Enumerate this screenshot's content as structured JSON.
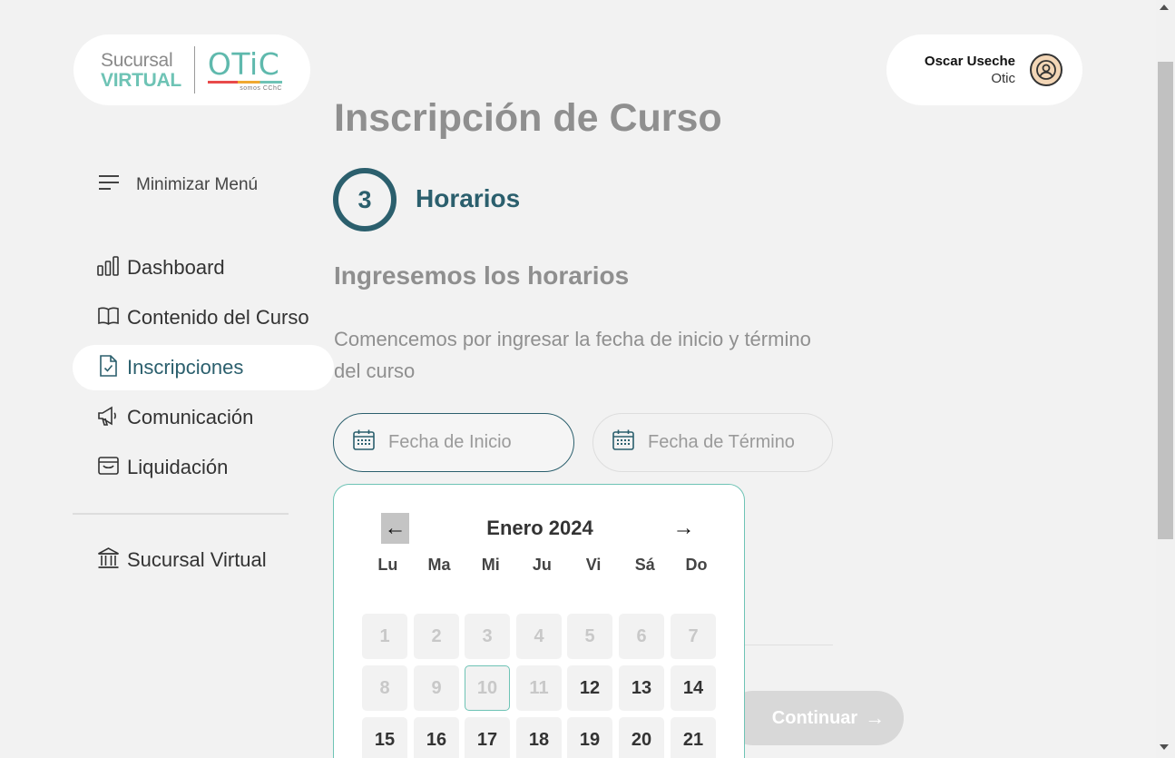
{
  "logo": {
    "line1": "Sucursal",
    "line2": "VIRTUAL",
    "brand": "OTiC",
    "tagline": "somos CChC"
  },
  "user": {
    "name": "Oscar Useche",
    "org": "Otic",
    "icon": "user-circle-icon"
  },
  "sidebar": {
    "minimize_label": "Minimizar Menú",
    "items": [
      {
        "label": "Dashboard",
        "icon": "bar-chart-icon"
      },
      {
        "label": "Contenido del Curso",
        "icon": "book-icon"
      },
      {
        "label": "Inscripciones",
        "icon": "file-check-icon",
        "active": true
      },
      {
        "label": "Comunicación",
        "icon": "megaphone-icon"
      },
      {
        "label": "Liquidación",
        "icon": "archive-box-icon"
      }
    ],
    "bottom_item": {
      "label": "Sucursal Virtual",
      "icon": "bank-icon"
    }
  },
  "main": {
    "title": "Inscripción de Curso",
    "step_number": "3",
    "step_title": "Horarios",
    "section_title": "Ingresemos los horarios",
    "section_desc": "Comencemos por ingresar la fecha de inicio y término del curso",
    "start_placeholder": "Fecha de Inicio",
    "end_placeholder": "Fecha de Término",
    "continue_label": "Continuar"
  },
  "calendar": {
    "prev_label": "←",
    "next_label": "→",
    "month": "Enero 2024",
    "weekdays": [
      "Lu",
      "Ma",
      "Mi",
      "Ju",
      "Vi",
      "Sá",
      "Do"
    ],
    "days": [
      {
        "d": "1",
        "state": "disabled"
      },
      {
        "d": "2",
        "state": "disabled"
      },
      {
        "d": "3",
        "state": "disabled"
      },
      {
        "d": "4",
        "state": "disabled"
      },
      {
        "d": "5",
        "state": "disabled"
      },
      {
        "d": "6",
        "state": "disabled"
      },
      {
        "d": "7",
        "state": "disabled"
      },
      {
        "d": "8",
        "state": "disabled"
      },
      {
        "d": "9",
        "state": "disabled"
      },
      {
        "d": "10",
        "state": "today"
      },
      {
        "d": "11",
        "state": "disabled"
      },
      {
        "d": "12",
        "state": "enabled"
      },
      {
        "d": "13",
        "state": "enabled"
      },
      {
        "d": "14",
        "state": "enabled"
      },
      {
        "d": "15",
        "state": "enabled"
      },
      {
        "d": "16",
        "state": "enabled"
      },
      {
        "d": "17",
        "state": "enabled"
      },
      {
        "d": "18",
        "state": "enabled"
      },
      {
        "d": "19",
        "state": "enabled"
      },
      {
        "d": "20",
        "state": "enabled"
      },
      {
        "d": "21",
        "state": "enabled"
      }
    ]
  },
  "colors": {
    "accent": "#2b5f6d",
    "teal": "#6ec3b5",
    "muted": "#8f8f8f"
  }
}
